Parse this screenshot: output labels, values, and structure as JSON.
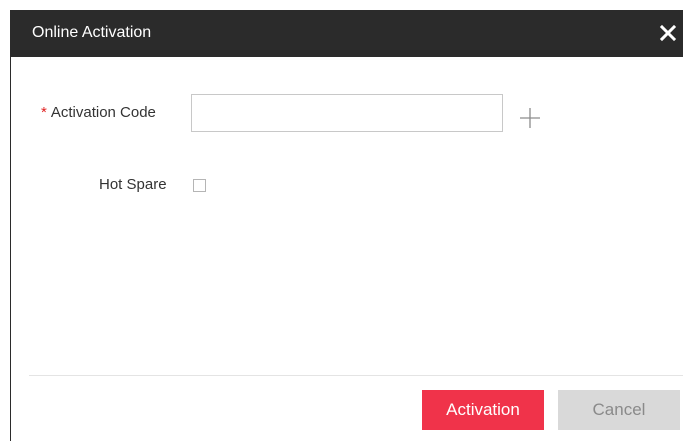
{
  "dialog": {
    "title": "Online Activation",
    "close_icon": "close-icon"
  },
  "form": {
    "activation_code": {
      "required_marker": "*",
      "label": "Activation Code",
      "value": "",
      "add_icon": "plus-icon"
    },
    "hot_spare": {
      "label": "Hot Spare",
      "checked": false
    }
  },
  "footer": {
    "activation_label": "Activation",
    "cancel_label": "Cancel"
  },
  "colors": {
    "titlebar": "#2b2b2b",
    "primary": "#f0334a",
    "secondary": "#d9d9d9",
    "required": "#e02020"
  }
}
